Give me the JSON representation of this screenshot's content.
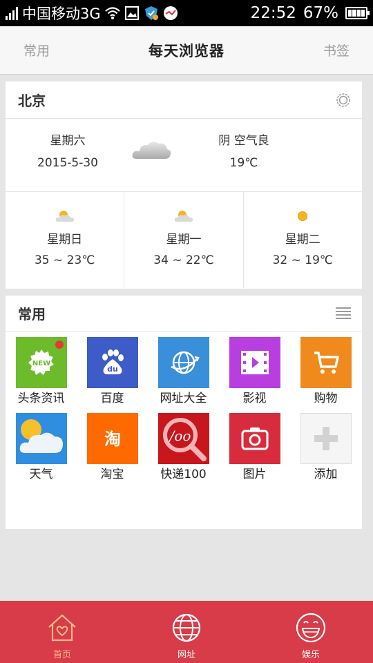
{
  "status_bar": {
    "carrier": "中国移动3G",
    "time": "22:52",
    "battery_pct": "67%"
  },
  "header": {
    "left_label": "常用",
    "title": "每天浏览器",
    "right_label": "书签"
  },
  "weather": {
    "city": "北京",
    "today": {
      "weekday": "星期六",
      "date": "2015-5-30",
      "condition": "阴 空气良",
      "temp": "19℃",
      "icon": "cloud-icon"
    },
    "forecast": [
      {
        "day": "星期日",
        "temp": "35 ~ 23℃",
        "icon": "partly-cloudy-icon"
      },
      {
        "day": "星期一",
        "temp": "34 ~ 22℃",
        "icon": "partly-cloudy-icon"
      },
      {
        "day": "星期二",
        "temp": "32 ~ 19℃",
        "icon": "sun-icon"
      }
    ]
  },
  "frequent": {
    "title": "常用",
    "apps": [
      {
        "label": "头条资讯",
        "color": "#6cbb2a",
        "icon": "news-icon"
      },
      {
        "label": "百度",
        "color": "#3d5cc7",
        "icon": "baidu-paw-icon"
      },
      {
        "label": "网址大全",
        "color": "#3a8fdb",
        "icon": "globe-icon"
      },
      {
        "label": "影视",
        "color": "#b93ee0",
        "icon": "film-icon"
      },
      {
        "label": "购物",
        "color": "#f08a1c",
        "icon": "cart-icon"
      },
      {
        "label": "天气",
        "color": "#2f8ee0",
        "icon": "weather-icon"
      },
      {
        "label": "淘宝",
        "color": "#ff6a00",
        "icon": "taobao-icon"
      },
      {
        "label": "快递100",
        "color": "#c8161d",
        "icon": "kuaidi-icon"
      },
      {
        "label": "图片",
        "color": "#d72c3d",
        "icon": "camera-icon"
      },
      {
        "label": "添加",
        "color": "#f5f5f5",
        "icon": "plus-icon"
      }
    ]
  },
  "bottom_nav": [
    {
      "label": "首页",
      "icon": "home-icon",
      "active": true
    },
    {
      "label": "网址",
      "icon": "globe-icon",
      "active": false
    },
    {
      "label": "娱乐",
      "icon": "smiley-icon",
      "active": false
    }
  ],
  "colors": {
    "nav_bg": "#d73c48",
    "nav_active": "#ffb98a"
  }
}
